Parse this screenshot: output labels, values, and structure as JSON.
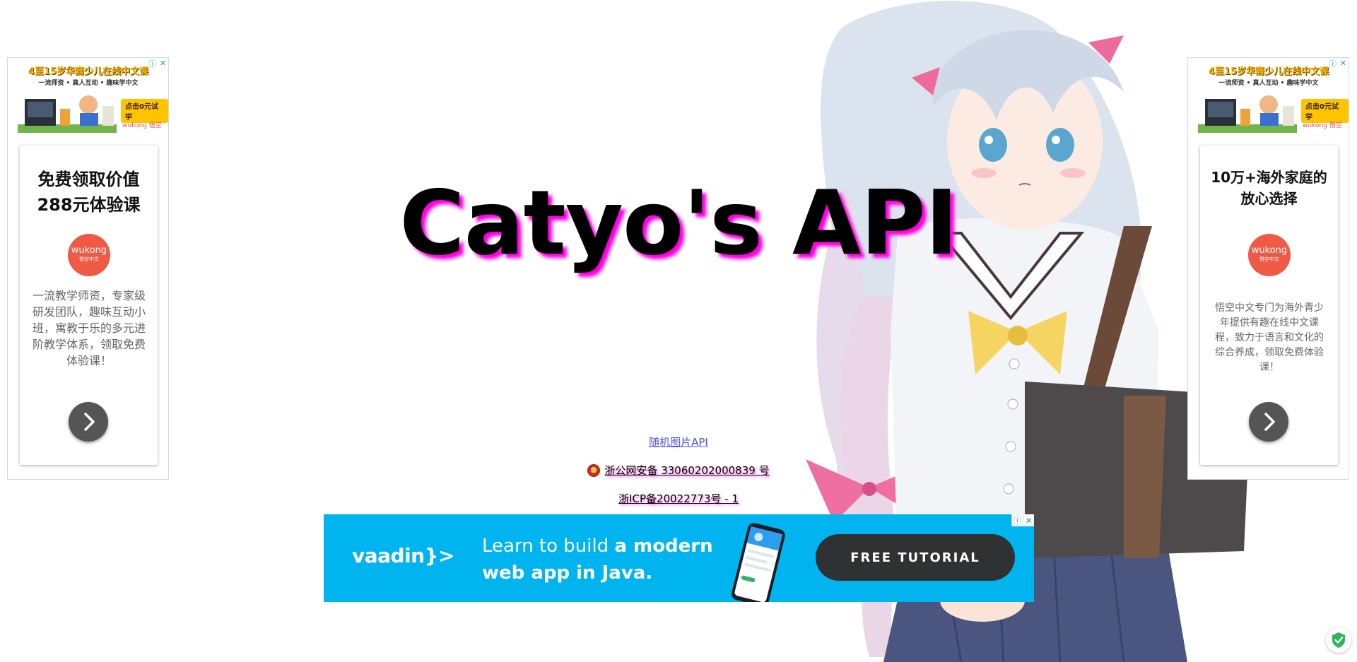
{
  "page": {
    "title": "Catyo's API"
  },
  "links": {
    "random_image": "随机图片API",
    "police_record": "浙公网安备 33060202000839 号",
    "icp_record": "浙ICP备20022773号 - 1"
  },
  "left_ad": {
    "top_headline": "4至15岁华裔少儿在线中文课",
    "top_sub": "一流师资 • 真人互动 • 趣味学中文",
    "top_cta": "点击0元试学",
    "top_brand": "wukong 悟空",
    "card_title": "免费领取价值288元体验课",
    "logo_main": "wukong",
    "logo_sub": "悟空中文",
    "card_body": "一流教学师资，专家级研发团队，趣味互动小班，寓教于乐的多元进阶教学体系，领取免费体验课！"
  },
  "right_ad": {
    "top_headline": "4至15岁华裔少儿在线中文课",
    "top_sub": "一流师资 • 真人互动 • 趣味学中文",
    "top_cta": "点击0元试学",
    "top_brand": "wukong 悟空",
    "card_title": "10万+海外家庭的放心选择",
    "logo_main": "wukong",
    "logo_sub": "悟空中文",
    "card_body": "悟空中文专门为海外青少年提供有趣在线中文课程，致力于语言和文化的综合养成，领取免费体验课！"
  },
  "banner": {
    "brand": "vaadin}>",
    "line1_pre": "Learn to build ",
    "line1_bold": "a modern",
    "line2": "web app in Java.",
    "cta": "FREE TUTORIAL"
  },
  "ad_choices": {
    "info": "ⓘ",
    "close": "✕"
  },
  "colors": {
    "title_shadow": "#ff00e1",
    "banner_bg": "#00b4f0",
    "ad_logo": "#ee5a45",
    "shield": "#2fb45a"
  }
}
